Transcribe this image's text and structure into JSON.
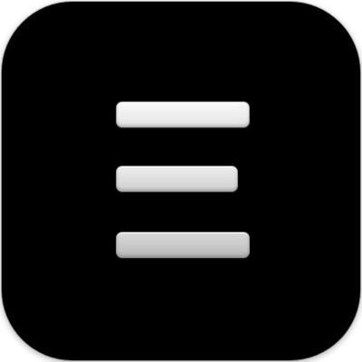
{
  "icon": {
    "name": "hamburger-menu-icon",
    "colors": {
      "tile_background": "#000000",
      "bar_top": "#f2f2f2",
      "bar_middle": "#dddddd",
      "bar_bottom": "#c8c8c8",
      "bar_border": "#8f8f8f"
    }
  }
}
